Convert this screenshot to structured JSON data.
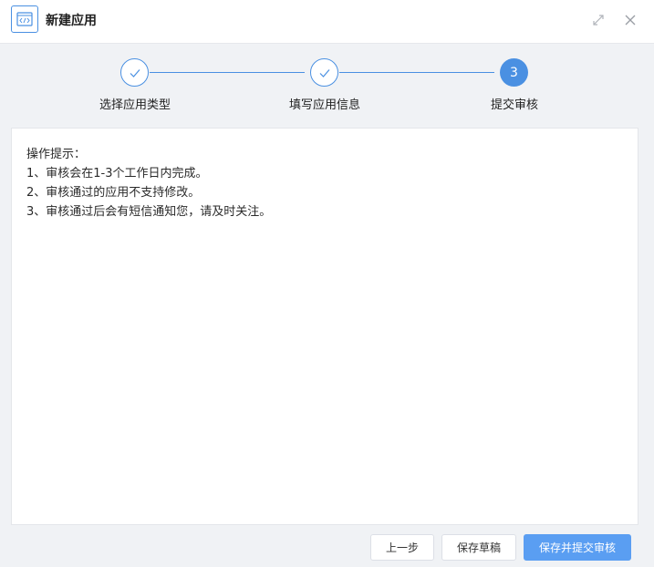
{
  "window": {
    "title": "新建应用",
    "icon": "code-icon"
  },
  "steps": [
    {
      "label": "选择应用类型",
      "status": "done",
      "number": ""
    },
    {
      "label": "填写应用信息",
      "status": "done",
      "number": ""
    },
    {
      "label": "提交审核",
      "status": "active",
      "number": "3"
    }
  ],
  "tips": {
    "heading": "操作提示：",
    "lines": [
      "1、审核会在1-3个工作日内完成。",
      "2、审核通过的应用不支持修改。",
      "3、审核通过后会有短信通知您，请及时关注。"
    ]
  },
  "footer": {
    "prev_label": "上一步",
    "draft_label": "保存草稿",
    "submit_label": "保存并提交审核"
  },
  "colors": {
    "accent": "#4a90e2",
    "primary_button": "#5a9ef2"
  }
}
